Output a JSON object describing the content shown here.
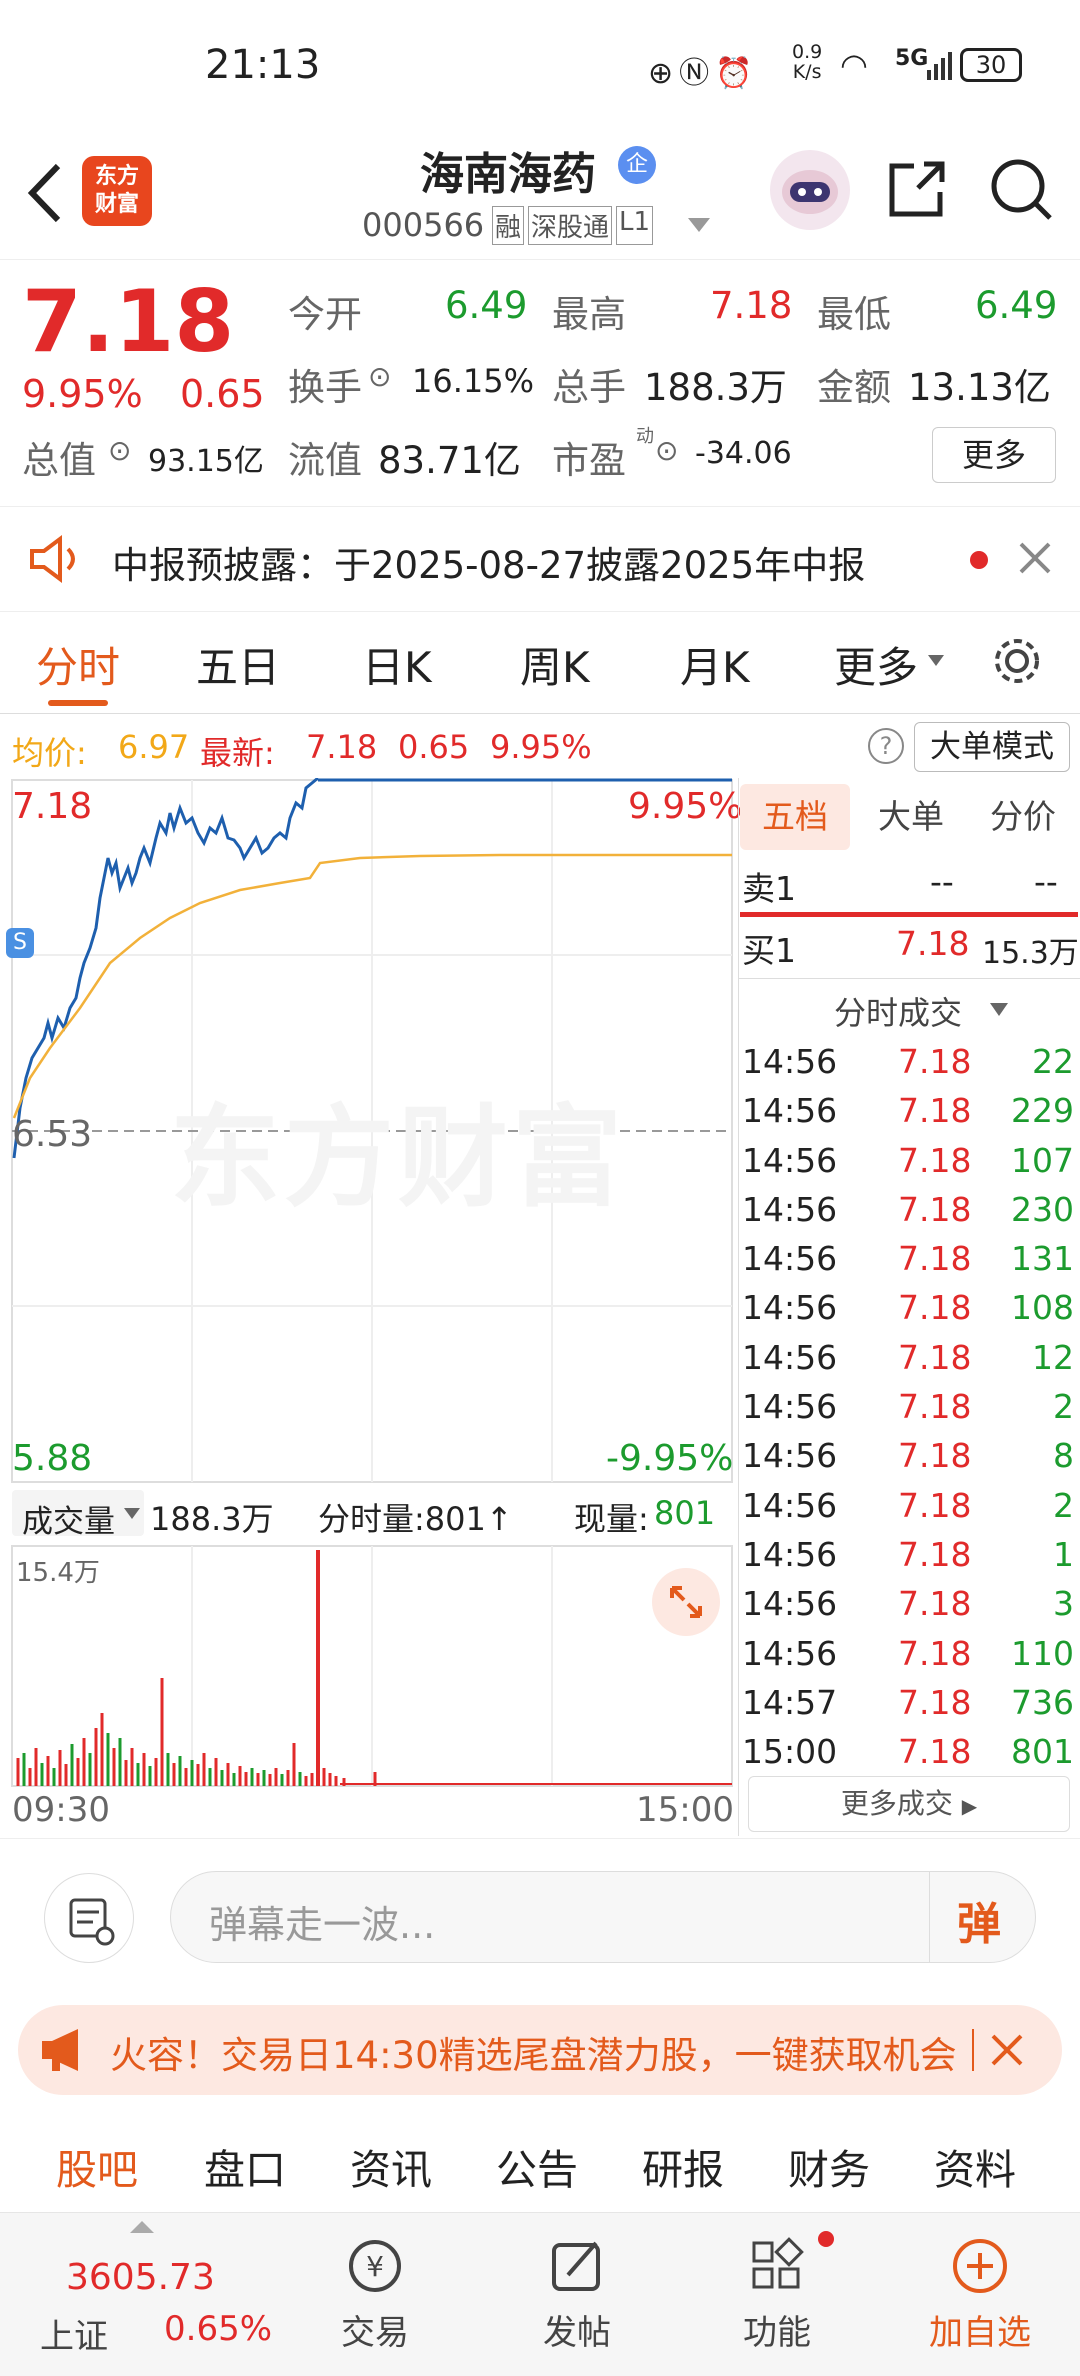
{
  "status": {
    "time": "21:13",
    "net_speed_top": "0.9",
    "net_speed_unit": "K/s",
    "signal": "5G",
    "battery": "30"
  },
  "header": {
    "title": "海南海药",
    "badge": "企",
    "code": "000566",
    "tags": [
      "融",
      "深股通",
      "L1"
    ]
  },
  "quote": {
    "price": "7.18",
    "change_pct": "9.95%",
    "change": "0.65",
    "open_label": "今开",
    "open": "6.49",
    "high_label": "最高",
    "high": "7.18",
    "low_label": "最低",
    "low": "6.49",
    "turnover_label": "换手",
    "turnover": "16.15%",
    "volume_label": "总手",
    "volume": "188.3万",
    "amount_label": "金额",
    "amount": "13.13亿",
    "mcap_label": "总值",
    "mcap": "93.15亿",
    "float_label": "流值",
    "float": "83.71亿",
    "pe_label": "市盈",
    "pe_sup": "动",
    "pe": "-34.06",
    "more_label": "更多"
  },
  "notice": {
    "text": "中报预披露：于2025-08-27披露2025年中报"
  },
  "tabs": [
    "分时",
    "五日",
    "日K",
    "周K",
    "月K",
    "更多"
  ],
  "info": {
    "avg_label": "均价:",
    "avg": "6.97",
    "latest_label": "最新:",
    "latest": "7.18",
    "chg": "0.65",
    "pct": "9.95%",
    "mode_label": "大单模式"
  },
  "chart": {
    "top_price": "7.18",
    "top_pct": "9.95%",
    "mid_price": "6.53",
    "bottom_price": "5.88",
    "bottom_pct": "-9.95%",
    "watermark": "东方财富",
    "s_marker": "S",
    "vol_label": "成交量",
    "vol_total": "188.3万",
    "vol_min": "分时量:801↑",
    "vol_now_label": "现量:",
    "vol_now": "801",
    "vol_max": "15.4万",
    "start_time": "09:30",
    "end_time": "15:00"
  },
  "chart_data": {
    "type": "line",
    "x": [
      "09:30",
      "15:00"
    ],
    "ylim": [
      5.88,
      7.18
    ],
    "series": [],
    "avg_price": "6.97"
  },
  "side": {
    "tabs": [
      "五档",
      "大单",
      "分价"
    ],
    "sell1_label": "卖1",
    "sell1_price": "--",
    "sell1_vol": "--",
    "buy1_label": "买1",
    "buy1_price": "7.18",
    "buy1_vol": "15.3万",
    "ticks_title": "分时成交",
    "ticks": [
      [
        "14:56",
        "7.18",
        "22"
      ],
      [
        "14:56",
        "7.18",
        "229"
      ],
      [
        "14:56",
        "7.18",
        "107"
      ],
      [
        "14:56",
        "7.18",
        "230"
      ],
      [
        "14:56",
        "7.18",
        "131"
      ],
      [
        "14:56",
        "7.18",
        "108"
      ],
      [
        "14:56",
        "7.18",
        "12"
      ],
      [
        "14:56",
        "7.18",
        "2"
      ],
      [
        "14:56",
        "7.18",
        "8"
      ],
      [
        "14:56",
        "7.18",
        "2"
      ],
      [
        "14:56",
        "7.18",
        "1"
      ],
      [
        "14:56",
        "7.18",
        "3"
      ],
      [
        "14:56",
        "7.18",
        "110"
      ],
      [
        "14:57",
        "7.18",
        "736"
      ],
      [
        "15:00",
        "7.18",
        "801"
      ]
    ],
    "more_label": "更多成交"
  },
  "danmu": {
    "placeholder": "弹幕走一波...",
    "send": "弹"
  },
  "banner": {
    "text": "火容！交易日14:30精选尾盘潜力股，一键获取机会"
  },
  "bottom_tabs": [
    "股吧",
    "盘口",
    "资讯",
    "公告",
    "研报",
    "财务",
    "资料"
  ],
  "bottombar": {
    "index_value": "3605.73",
    "index_name": "上证",
    "index_pct": "0.65%",
    "trade": "交易",
    "post": "发帖",
    "func": "功能",
    "add": "加自选"
  },
  "colors": {
    "red": "#e12a2a",
    "green": "#1c9b2e",
    "orange": "#e35a1c",
    "blue": "#1e5fae",
    "avg": "#f2b13a"
  }
}
